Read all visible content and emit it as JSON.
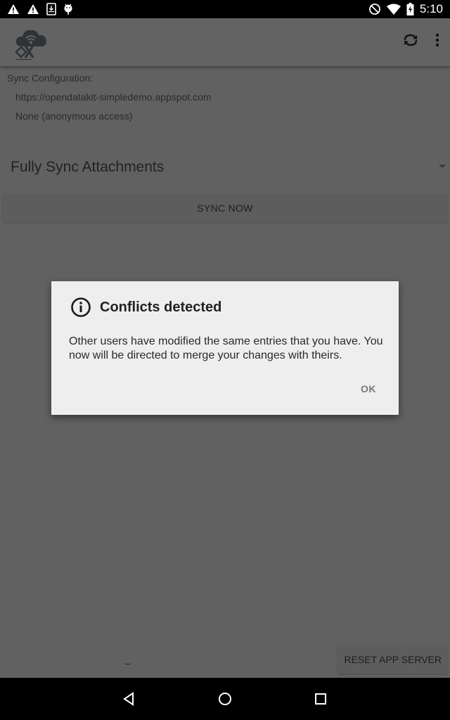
{
  "status_bar": {
    "left_icons": [
      "warning-icon",
      "warning-icon",
      "download-icon",
      "android-debug-icon"
    ],
    "right_icons": [
      "do-not-disturb-icon",
      "wifi-icon",
      "battery-charging-icon"
    ],
    "time": "5:10"
  },
  "app_bar": {
    "logo": "odk-sync-logo",
    "actions": [
      {
        "icon": "sync-icon",
        "label": "Sync"
      },
      {
        "icon": "more-vert-icon",
        "label": "More options"
      }
    ]
  },
  "sync_config": {
    "label": "Sync Configuration:",
    "server_url": "https://opendatakit-simpledemo.appspot.com",
    "auth": "None (anonymous access)"
  },
  "attachment_spinner": {
    "selected": "Fully Sync Attachments"
  },
  "buttons": {
    "sync_now": "SYNC NOW",
    "reset_app_server": "RESET APP SERVER"
  },
  "footer_text": "_",
  "dialog": {
    "icon": "info-icon",
    "title": "Conflicts detected",
    "message": "Other users have modified the same entries that you have. You now will be directed to merge your changes with theirs.",
    "ok_label": "OK"
  },
  "nav_bar": {
    "buttons": [
      "back-icon",
      "home-icon",
      "recents-icon"
    ]
  },
  "colors": {
    "scrim_background": "#616161",
    "dialog_background": "#eeeeee",
    "status_bar": "#000000"
  }
}
